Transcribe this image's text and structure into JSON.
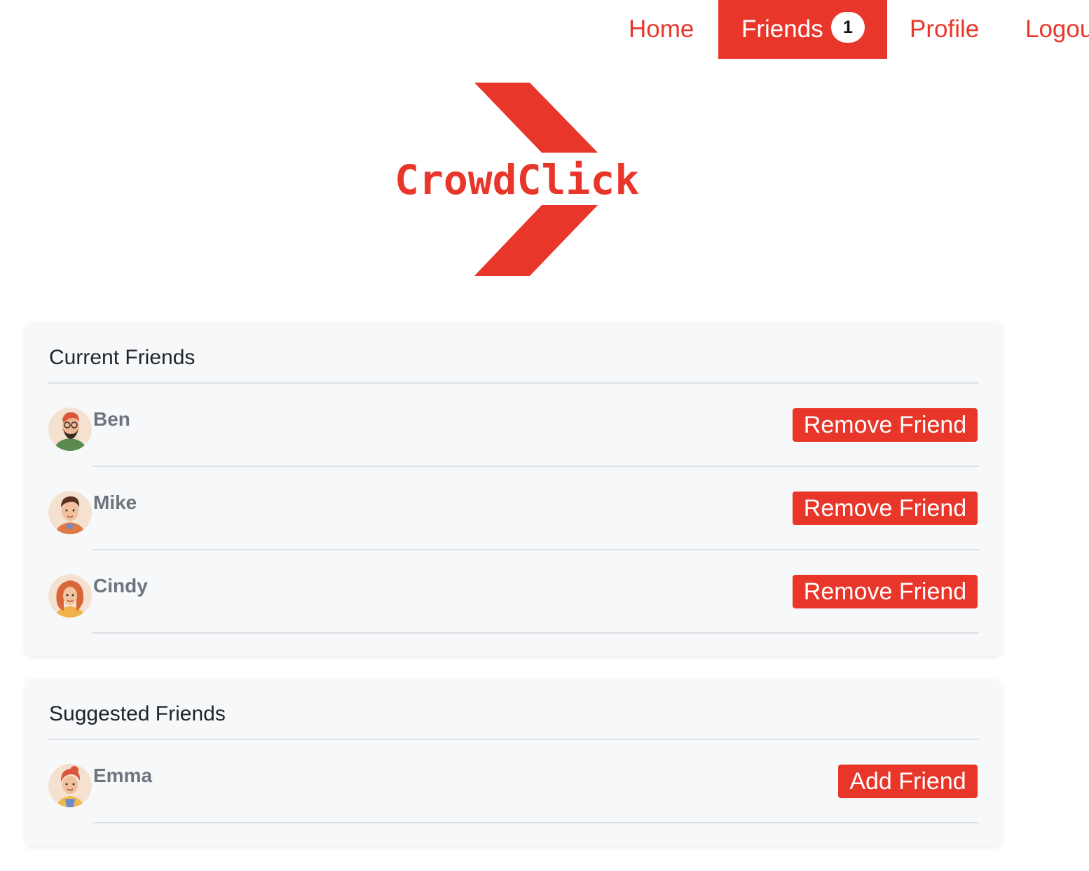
{
  "nav": {
    "home": "Home",
    "friends": "Friends",
    "friends_badge": "1",
    "profile": "Profile",
    "logout": "Logout"
  },
  "logo": {
    "text": "CrowdClick",
    "color": "#e8372a"
  },
  "current_friends": {
    "title": "Current Friends",
    "items": [
      {
        "name": "Ben",
        "button": "Remove Friend",
        "avatar": "avatar-ben"
      },
      {
        "name": "Mike",
        "button": "Remove Friend",
        "avatar": "avatar-mike"
      },
      {
        "name": "Cindy",
        "button": "Remove Friend",
        "avatar": "avatar-cindy"
      }
    ]
  },
  "suggested_friends": {
    "title": "Suggested Friends",
    "items": [
      {
        "name": "Emma",
        "button": "Add Friend",
        "avatar": "avatar-emma"
      }
    ]
  },
  "colors": {
    "accent": "#e8372a",
    "card_background": "#f7f8fa",
    "name_text": "#6c757d"
  }
}
